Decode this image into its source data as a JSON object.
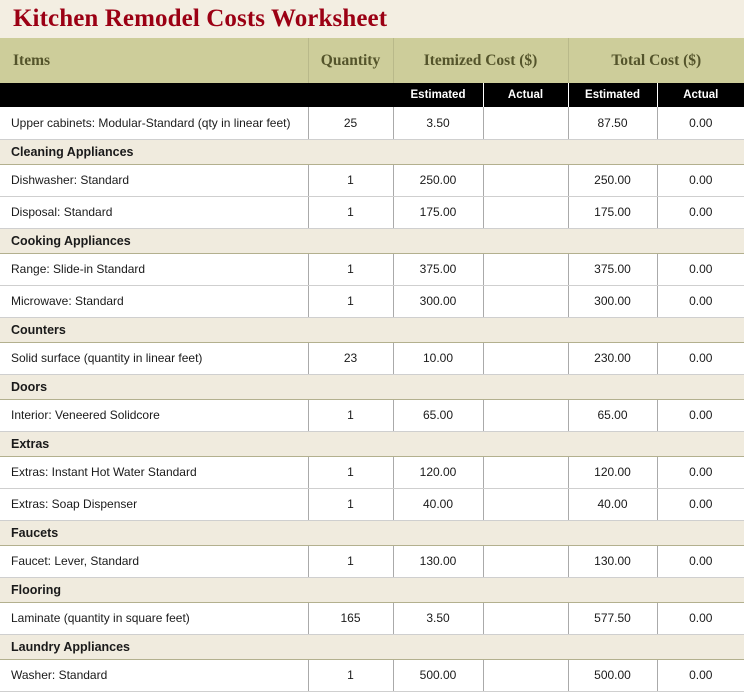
{
  "title": "Kitchen Remodel Costs Worksheet",
  "colors": {
    "title_text": "#9B0014",
    "page_background": "#F3EEE2",
    "group_header_background": "#CDCD9A",
    "group_header_text": "#54542B",
    "sub_header_background": "#000000",
    "sub_header_text": "#FFFFFF",
    "section_row_background": "#F0EBDE",
    "data_row_background": "#FFFFFF"
  },
  "table": {
    "group_headers": [
      {
        "label": "Items",
        "span": 1,
        "align": "left"
      },
      {
        "label": "Quantity",
        "span": 1,
        "align": "center"
      },
      {
        "label": "Itemized Cost ($)",
        "span": 2,
        "align": "center"
      },
      {
        "label": "Total Cost ($)",
        "span": 2,
        "align": "center"
      }
    ],
    "sub_headers": [
      "",
      "",
      "Estimated",
      "Actual",
      "Estimated",
      "Actual"
    ],
    "rows": [
      {
        "type": "data",
        "item": "Upper cabinets: Modular-Standard (qty in linear feet)",
        "quantity": "25",
        "itemized_estimated": "3.50",
        "itemized_actual": "",
        "total_estimated": "87.50",
        "total_actual": "0.00"
      },
      {
        "type": "section",
        "label": "Cleaning Appliances"
      },
      {
        "type": "data",
        "item": "Dishwasher: Standard",
        "quantity": "1",
        "itemized_estimated": "250.00",
        "itemized_actual": "",
        "total_estimated": "250.00",
        "total_actual": "0.00"
      },
      {
        "type": "data",
        "item": "Disposal: Standard",
        "quantity": "1",
        "itemized_estimated": "175.00",
        "itemized_actual": "",
        "total_estimated": "175.00",
        "total_actual": "0.00"
      },
      {
        "type": "section",
        "label": "Cooking Appliances"
      },
      {
        "type": "data",
        "item": "Range: Slide-in Standard",
        "quantity": "1",
        "itemized_estimated": "375.00",
        "itemized_actual": "",
        "total_estimated": "375.00",
        "total_actual": "0.00"
      },
      {
        "type": "data",
        "item": "Microwave: Standard",
        "quantity": "1",
        "itemized_estimated": "300.00",
        "itemized_actual": "",
        "total_estimated": "300.00",
        "total_actual": "0.00"
      },
      {
        "type": "section",
        "label": "Counters"
      },
      {
        "type": "data",
        "item": "Solid surface (quantity in linear feet)",
        "quantity": "23",
        "itemized_estimated": "10.00",
        "itemized_actual": "",
        "total_estimated": "230.00",
        "total_actual": "0.00"
      },
      {
        "type": "section",
        "label": "Doors"
      },
      {
        "type": "data",
        "item": "Interior: Veneered Solidcore",
        "quantity": "1",
        "itemized_estimated": "65.00",
        "itemized_actual": "",
        "total_estimated": "65.00",
        "total_actual": "0.00"
      },
      {
        "type": "section",
        "label": "Extras"
      },
      {
        "type": "data",
        "item": "Extras: Instant Hot Water Standard",
        "quantity": "1",
        "itemized_estimated": "120.00",
        "itemized_actual": "",
        "total_estimated": "120.00",
        "total_actual": "0.00"
      },
      {
        "type": "data",
        "item": "Extras: Soap Dispenser",
        "quantity": "1",
        "itemized_estimated": "40.00",
        "itemized_actual": "",
        "total_estimated": "40.00",
        "total_actual": "0.00"
      },
      {
        "type": "section",
        "label": "Faucets"
      },
      {
        "type": "data",
        "item": "Faucet: Lever, Standard",
        "quantity": "1",
        "itemized_estimated": "130.00",
        "itemized_actual": "",
        "total_estimated": "130.00",
        "total_actual": "0.00"
      },
      {
        "type": "section",
        "label": "Flooring"
      },
      {
        "type": "data",
        "item": "Laminate (quantity in square feet)",
        "quantity": "165",
        "itemized_estimated": "3.50",
        "itemized_actual": "",
        "total_estimated": "577.50",
        "total_actual": "0.00"
      },
      {
        "type": "section",
        "label": "Laundry Appliances"
      },
      {
        "type": "data",
        "item": "Washer: Standard",
        "quantity": "1",
        "itemized_estimated": "500.00",
        "itemized_actual": "",
        "total_estimated": "500.00",
        "total_actual": "0.00"
      }
    ]
  }
}
